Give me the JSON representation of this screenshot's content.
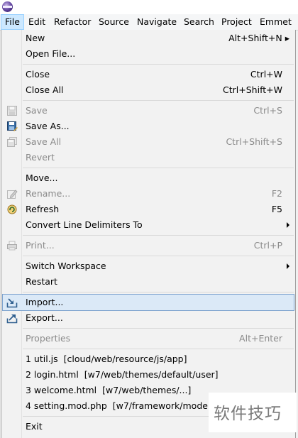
{
  "menubar": {
    "items": [
      {
        "label": "File",
        "active": true
      },
      {
        "label": "Edit"
      },
      {
        "label": "Refactor"
      },
      {
        "label": "Source"
      },
      {
        "label": "Navigate"
      },
      {
        "label": "Search"
      },
      {
        "label": "Project"
      },
      {
        "label": "Emmet"
      }
    ]
  },
  "file_menu": {
    "new": {
      "label": "New",
      "shortcut": "Alt+Shift+N ▸"
    },
    "open_file": {
      "label": "Open File..."
    },
    "close": {
      "label": "Close",
      "shortcut": "Ctrl+W"
    },
    "close_all": {
      "label": "Close All",
      "shortcut": "Ctrl+Shift+W"
    },
    "save": {
      "label": "Save",
      "shortcut": "Ctrl+S",
      "disabled": true
    },
    "save_as": {
      "label": "Save As..."
    },
    "save_all": {
      "label": "Save All",
      "shortcut": "Ctrl+Shift+S",
      "disabled": true
    },
    "revert": {
      "label": "Revert",
      "disabled": true
    },
    "move": {
      "label": "Move..."
    },
    "rename": {
      "label": "Rename...",
      "shortcut": "F2",
      "disabled": true
    },
    "refresh": {
      "label": "Refresh",
      "shortcut": "F5"
    },
    "convert_line_delimiters": {
      "label": "Convert Line Delimiters To"
    },
    "print": {
      "label": "Print...",
      "shortcut": "Ctrl+P",
      "disabled": true
    },
    "switch_workspace": {
      "label": "Switch Workspace"
    },
    "restart": {
      "label": "Restart"
    },
    "import": {
      "label": "Import...",
      "selected": true
    },
    "export": {
      "label": "Export..."
    },
    "properties": {
      "label": "Properties",
      "shortcut": "Alt+Enter",
      "disabled": true
    },
    "recent_files": [
      {
        "label": "1 util.js",
        "path": "[cloud/web/resource/js/app]"
      },
      {
        "label": "2 login.html",
        "path": "[w7/web/themes/default/user]"
      },
      {
        "label": "3 welcome.html",
        "path": "[w7/web/themes/...]"
      },
      {
        "label": "4 setting.mod.php",
        "path": "[w7/framework/model]"
      }
    ],
    "exit": {
      "label": "Exit"
    }
  },
  "watermark": {
    "text": "软件技巧"
  },
  "colors": {
    "selection_bg": "#dbe9f7",
    "selection_border": "#7da2ce",
    "menubar_active_bg": "#cce8ff",
    "disabled_text": "#8a8a8a"
  }
}
